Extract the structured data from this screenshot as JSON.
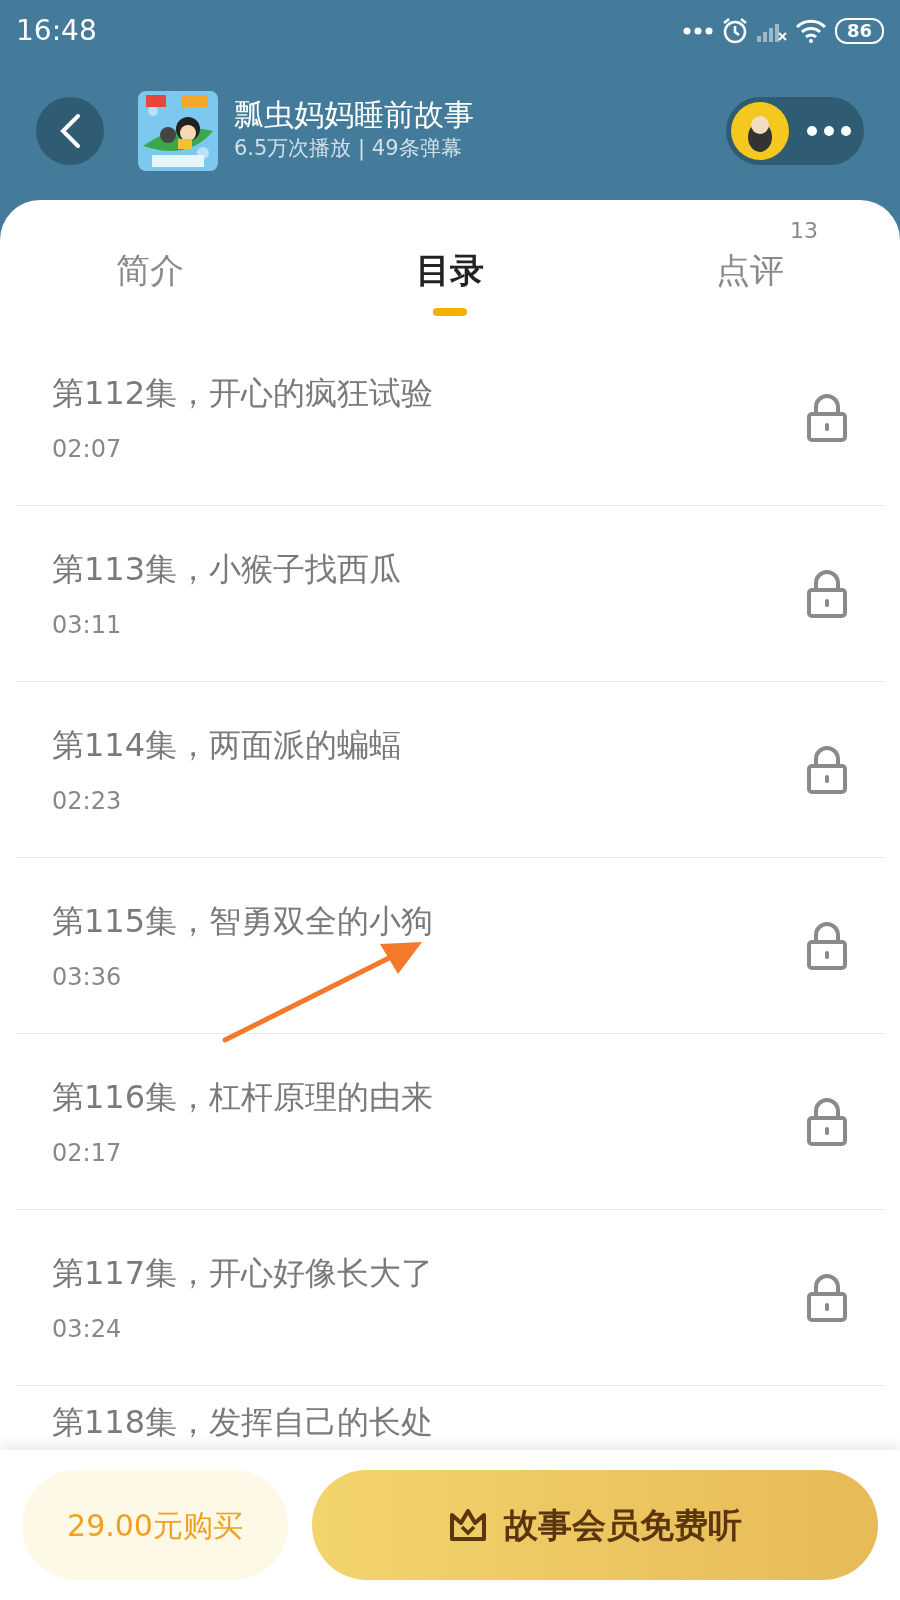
{
  "status_bar": {
    "time": "16:48",
    "battery": "86"
  },
  "header": {
    "title": "瓢虫妈妈睡前故事",
    "subtitle": "6.5万次播放 | 49条弹幕"
  },
  "tabs": [
    {
      "label": "简介",
      "selected": false
    },
    {
      "label": "目录",
      "selected": true
    },
    {
      "label": "点评",
      "selected": false,
      "badge": "13"
    }
  ],
  "episodes": [
    {
      "title": "第112集，开心的疯狂试验",
      "duration": "02:07",
      "locked": true
    },
    {
      "title": "第113集，小猴子找西瓜",
      "duration": "03:11",
      "locked": true
    },
    {
      "title": "第114集，两面派的蝙蝠",
      "duration": "02:23",
      "locked": true
    },
    {
      "title": "第115集，智勇双全的小狗",
      "duration": "03:36",
      "locked": true
    },
    {
      "title": "第116集，杠杆原理的由来",
      "duration": "02:17",
      "locked": true
    },
    {
      "title": "第117集，开心好像长大了",
      "duration": "03:24",
      "locked": true
    },
    {
      "title": "第118集，发挥自己的长处"
    }
  ],
  "bottom_bar": {
    "buy_button": "29.00元购买",
    "member_button": "故事会员免费听"
  }
}
